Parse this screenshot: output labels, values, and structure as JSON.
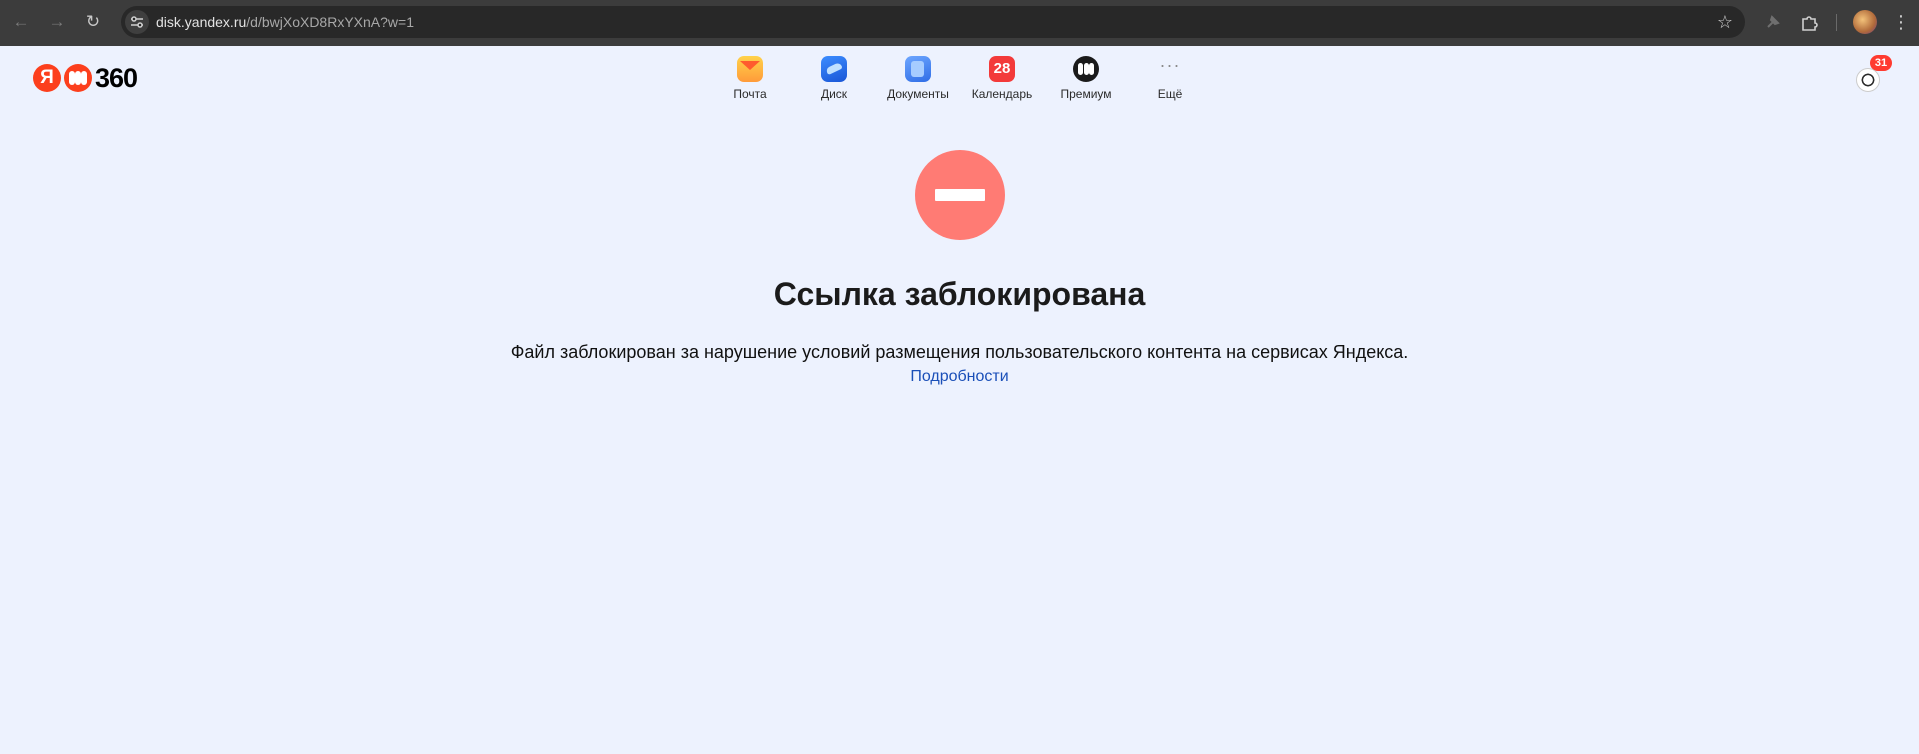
{
  "browser": {
    "url_host": "disk.yandex.ru",
    "url_path": "/d/bwjXoXD8RxYXnA?w=1"
  },
  "header": {
    "logo_letter": "Я",
    "logo_text": "360",
    "services": [
      {
        "label": "Почта",
        "icon": "mail-icon"
      },
      {
        "label": "Диск",
        "icon": "disk-icon"
      },
      {
        "label": "Документы",
        "icon": "documents-icon"
      },
      {
        "label": "Календарь",
        "icon": "calendar-icon",
        "icon_text": "28"
      },
      {
        "label": "Премиум",
        "icon": "premium-icon"
      },
      {
        "label": "Ещё",
        "icon": "more-icon",
        "icon_text": "···"
      }
    ],
    "notifications_count": "31"
  },
  "main": {
    "title": "Ссылка заблокирована",
    "description": "Файл заблокирован за нарушение условий размещения пользовательского контента на сервисах Яндекса.",
    "details_link": "Подробности"
  },
  "colors": {
    "page_background": "#edf2fe",
    "blocked_icon": "#ff7b74",
    "link": "#1a4fb8"
  }
}
